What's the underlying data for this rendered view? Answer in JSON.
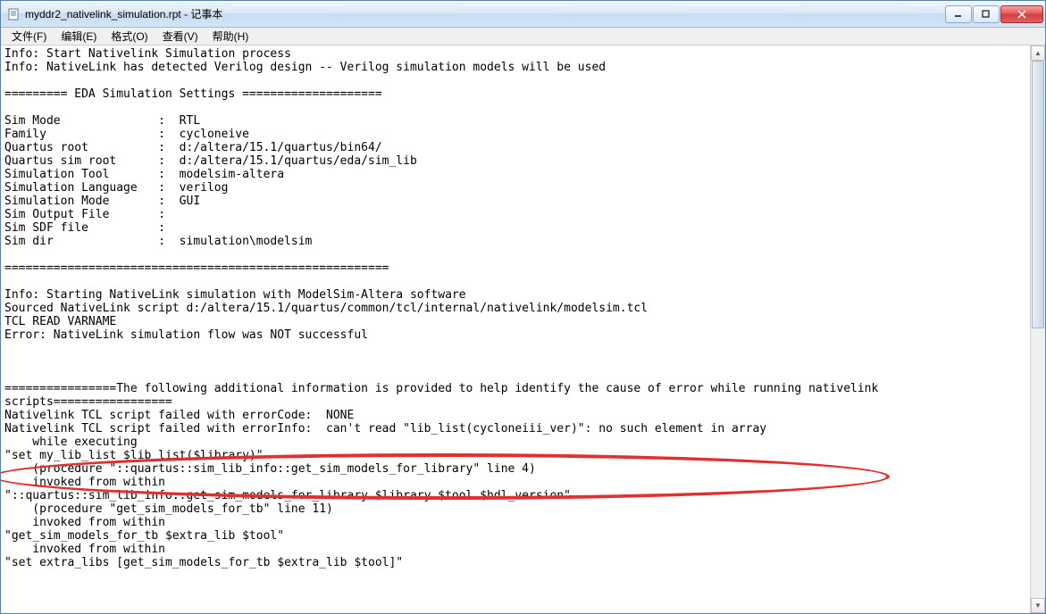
{
  "window": {
    "title": "myddr2_nativelink_simulation.rpt - 记事本"
  },
  "menu": {
    "file": "文件(F)",
    "edit": "编辑(E)",
    "format": "格式(O)",
    "view": "查看(V)",
    "help": "帮助(H)"
  },
  "content": {
    "line01": "Info: Start Nativelink Simulation process",
    "line02": "Info: NativeLink has detected Verilog design -- Verilog simulation models will be used",
    "line03": "",
    "line04": "========= EDA Simulation Settings ====================",
    "line05": "",
    "line06": "Sim Mode              :  RTL",
    "line07": "Family                :  cycloneive",
    "line08": "Quartus root          :  d:/altera/15.1/quartus/bin64/",
    "line09": "Quartus sim root      :  d:/altera/15.1/quartus/eda/sim_lib",
    "line10": "Simulation Tool       :  modelsim-altera",
    "line11": "Simulation Language   :  verilog",
    "line12": "Simulation Mode       :  GUI",
    "line13": "Sim Output File       :  ",
    "line14": "Sim SDF file          :  ",
    "line15": "Sim dir               :  simulation\\modelsim",
    "line16": "",
    "line17": "=======================================================",
    "line18": "",
    "line19": "Info: Starting NativeLink simulation with ModelSim-Altera software",
    "line20": "Sourced NativeLink script d:/altera/15.1/quartus/common/tcl/internal/nativelink/modelsim.tcl",
    "line21": "TCL READ VARNAME ",
    "line22": "Error: NativeLink simulation flow was NOT successful",
    "line23": "",
    "line24": "",
    "line25": "",
    "line26": "================The following additional information is provided to help identify the cause of error while running nativelink ",
    "line27": "scripts=================",
    "line28": "Nativelink TCL script failed with errorCode:  NONE",
    "line29": "Nativelink TCL script failed with errorInfo:  can't read \"lib_list(cycloneiii_ver)\": no such element in array",
    "line30": "    while executing",
    "line31": "\"set my_lib_list $lib_list($library)\"",
    "line32": "    (procedure \"::quartus::sim_lib_info::get_sim_models_for_library\" line 4)",
    "line33": "    invoked from within",
    "line34": "\"::quartus::sim_lib_info::get_sim_models_for_library $library $tool $hdl_version\"",
    "line35": "    (procedure \"get_sim_models_for_tb\" line 11)",
    "line36": "    invoked from within",
    "line37": "\"get_sim_models_for_tb $extra_lib $tool\"",
    "line38": "    invoked from within",
    "line39": "\"set extra_libs [get_sim_models_for_tb $extra_lib $tool]\""
  }
}
